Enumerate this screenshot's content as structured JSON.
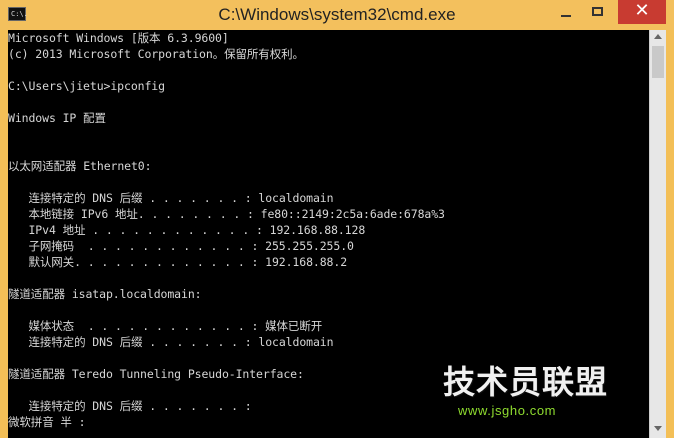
{
  "titlebar": {
    "icon_text": "C:\\.",
    "title": "C:\\Windows\\system32\\cmd.exe",
    "close_symbol": "✕"
  },
  "console": {
    "lines": [
      "Microsoft Windows [版本 6.3.9600]",
      "(c) 2013 Microsoft Corporation。保留所有权利。",
      "",
      "C:\\Users\\jietu>ipconfig",
      "",
      "Windows IP 配置",
      "",
      "",
      "以太网适配器 Ethernet0:",
      "",
      "   连接特定的 DNS 后缀 . . . . . . . : localdomain",
      "   本地链接 IPv6 地址. . . . . . . . : fe80::2149:2c5a:6ade:678a%3",
      "   IPv4 地址 . . . . . . . . . . . . : 192.168.88.128",
      "   子网掩码  . . . . . . . . . . . . : 255.255.255.0",
      "   默认网关. . . . . . . . . . . . . : 192.168.88.2",
      "",
      "隧道适配器 isatap.localdomain:",
      "",
      "   媒体状态  . . . . . . . . . . . . : 媒体已断开",
      "   连接特定的 DNS 后缀 . . . . . . . : localdomain",
      "",
      "隧道适配器 Teredo Tunneling Pseudo-Interface:",
      "",
      "   连接特定的 DNS 后缀 . . . . . . . :",
      "微软拼音 半 :"
    ]
  },
  "watermark": {
    "text": "技术员联盟",
    "url": "www.jsgho.com"
  },
  "colors": {
    "frame": "#f3bf57",
    "close": "#c83b31",
    "console_bg": "#000000",
    "console_text": "#d6d6d6"
  }
}
